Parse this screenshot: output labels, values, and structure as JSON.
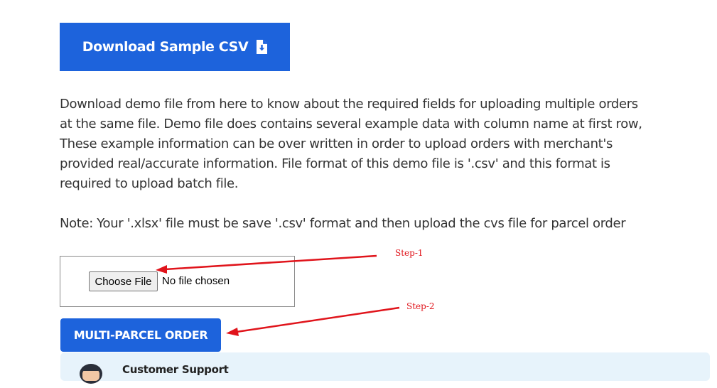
{
  "download_button": {
    "label": "Download Sample CSV",
    "icon": "file-download-icon"
  },
  "description": "Download demo file from here to know about the required fields for uploading multiple orders at the same file. Demo file does contains several example data with column name at first row, These example information can be over written in order to upload orders with merchant's provided real/accurate information. File format of this demo file is '.csv' and this format is required to upload batch file.",
  "note": "Note: Your '.xlsx' file must be save '.csv' format and then upload the cvs file for parcel order",
  "file_input": {
    "button_label": "Choose File",
    "status": "No file chosen"
  },
  "annotations": {
    "step1": "Step-1",
    "step2": "Step-2",
    "arrow_color": "#e0141b"
  },
  "submit_button": {
    "label": "MULTI-PARCEL ORDER"
  },
  "support": {
    "title": "Customer Support"
  },
  "colors": {
    "primary": "#1d63dc",
    "support_bg": "#e7f3fb",
    "text": "#333333"
  }
}
